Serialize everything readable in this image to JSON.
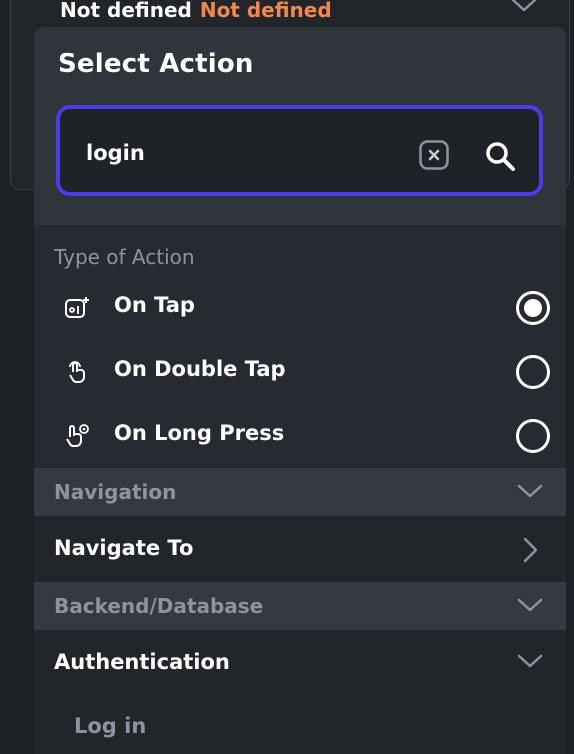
{
  "background_row": {
    "label": "Not defined",
    "value": "Not defined"
  },
  "panel": {
    "title": "Select Action",
    "search": {
      "value": "login",
      "placeholder": ""
    }
  },
  "type_of_action": {
    "label": "Type of Action",
    "options": [
      {
        "label": "On Tap",
        "icon": "tap-icon",
        "selected": true
      },
      {
        "label": "On Double Tap",
        "icon": "double-tap-icon",
        "selected": false
      },
      {
        "label": "On Long Press",
        "icon": "long-press-icon",
        "selected": false
      }
    ]
  },
  "categories": [
    {
      "label": "Navigation",
      "items": [
        {
          "label": "Navigate To"
        }
      ]
    },
    {
      "label": "Backend/Database",
      "items": [
        {
          "label": "Authentication",
          "subitems": [
            {
              "label": "Log in"
            }
          ]
        }
      ]
    }
  ],
  "colors": {
    "accent": "#4b3ee6",
    "orange": "#f2884b",
    "muted": "#8e949d"
  }
}
